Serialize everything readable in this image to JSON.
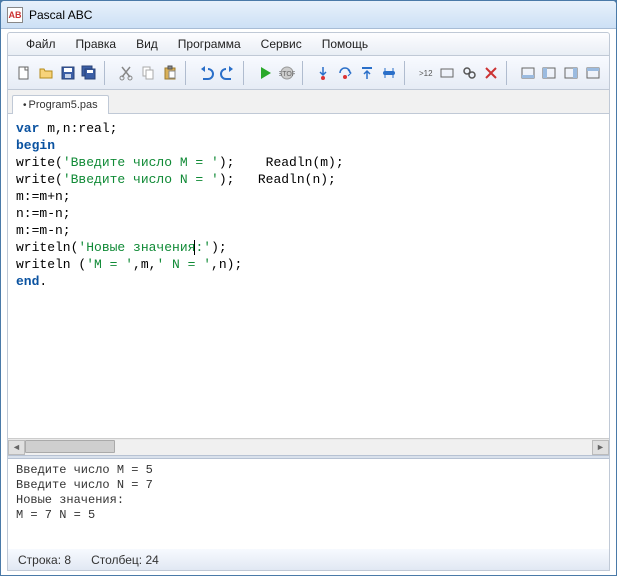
{
  "window": {
    "title": "Pascal ABC"
  },
  "menu": {
    "file": "Файл",
    "edit": "Правка",
    "view": "Вид",
    "program": "Программа",
    "service": "Сервис",
    "help": "Помощь"
  },
  "tabs": {
    "active": "Program5.pas"
  },
  "code": {
    "l1a": "var",
    "l1b": " m,n:real;",
    "l2": "begin",
    "l3a": "write(",
    "l3s": "'Введите число M = '",
    "l3b": ");    Readln(m);",
    "l4a": "write(",
    "l4s": "'Введите число N = '",
    "l4b": ");   Readln(n);",
    "l5": "m:=m+n;",
    "l6": "n:=m-n;",
    "l7": "m:=m-n;",
    "l8a": "writeln(",
    "l8s1": "'Новые значения",
    "l8s2": ":'",
    "l8b": ");",
    "l9a": "writeln (",
    "l9s1": "'M = '",
    "l9b": ",m,",
    "l9s2": "' N = '",
    "l9c": ",n);",
    "l10": "end",
    "l10b": "."
  },
  "output": {
    "l1": "Введите число M = 5",
    "l2": "Введите число N = 7",
    "l3": "Новые значения:",
    "l4": "M = 7 N = 5"
  },
  "status": {
    "line_label": "Строка:",
    "line_val": "8",
    "col_label": "Столбец:",
    "col_val": "24"
  }
}
